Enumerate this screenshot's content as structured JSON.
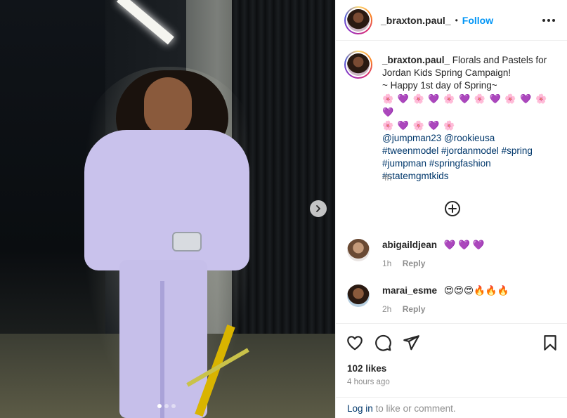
{
  "post": {
    "username": "_braxton.paul_",
    "follow_label": "Follow",
    "separator": "•",
    "caption": {
      "line1": "Florals and Pastels for Jordan Kids Spring Campaign!",
      "line2": "~ Happy 1st day of Spring~",
      "emojis_row1": "🌸 💜 🌸 💜 🌸 💜 🌸 💜 🌸 💜 🌸 💜",
      "emojis_row2": "🌸 💜 🌸 💜 🌸",
      "mentions": "@jumpman23 @rookieusa",
      "hashtags1": "#tweenmodel #jordanmodel #spring",
      "hashtags2": "#jumpman #springfashion",
      "hashtags3": "#statemgmtkids",
      "time": "4h"
    },
    "comments": [
      {
        "user": "abigaildjean",
        "text": "💜 💜 💜",
        "time": "1h",
        "reply": "Reply"
      },
      {
        "user": "marai_esme",
        "text": "😍😍😍🔥🔥🔥",
        "time": "2h",
        "reply": "Reply"
      }
    ],
    "likes": "102 likes",
    "posted_ago": "4 hours ago",
    "login_link": "Log in",
    "login_rest": " to like or comment."
  },
  "icons": {
    "more": "more-horizontal-icon",
    "next": "chevron-right-icon",
    "add": "plus-circle-icon",
    "like": "heart-icon",
    "comment": "comment-icon",
    "share": "send-icon",
    "save": "bookmark-icon"
  },
  "carousel": {
    "slides": 3,
    "active": 1
  },
  "colors": {
    "link": "#0095f6",
    "hashtag": "#00376b",
    "muted": "#8e8e8e"
  }
}
